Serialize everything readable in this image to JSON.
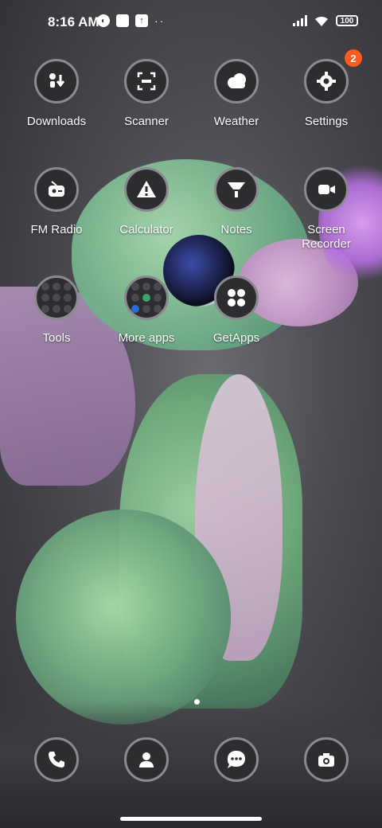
{
  "status_bar": {
    "time": "8:16 AM",
    "battery": "100",
    "icons": [
      "data-saver-icon",
      "notification-square-icon",
      "upload-icon",
      "more-dots-icon",
      "signal-icon",
      "wifi-icon",
      "battery-icon"
    ]
  },
  "apps": [
    {
      "label": "Downloads",
      "icon": "downloads-icon"
    },
    {
      "label": "Scanner",
      "icon": "scanner-icon"
    },
    {
      "label": "Weather",
      "icon": "weather-icon"
    },
    {
      "label": "Settings",
      "icon": "settings-gear-icon",
      "badge": "2"
    },
    {
      "label": "FM Radio",
      "icon": "fm-radio-icon"
    },
    {
      "label": "Calculator",
      "icon": "calculator-icon"
    },
    {
      "label": "Notes",
      "icon": "notes-icon"
    },
    {
      "label": "Screen Recorder",
      "icon": "screen-recorder-icon"
    },
    {
      "label": "Tools",
      "icon": "folder-icon"
    },
    {
      "label": "More apps",
      "icon": "folder-icon"
    },
    {
      "label": "GetApps",
      "icon": "getapps-icon"
    }
  ],
  "dock": [
    {
      "icon": "phone-icon"
    },
    {
      "icon": "contacts-icon"
    },
    {
      "icon": "messages-icon"
    },
    {
      "icon": "camera-icon"
    }
  ],
  "colors": {
    "badge": "#ff5a1f",
    "icon_bg": "#2d2d30",
    "icon_ring": "#8a8a90"
  }
}
